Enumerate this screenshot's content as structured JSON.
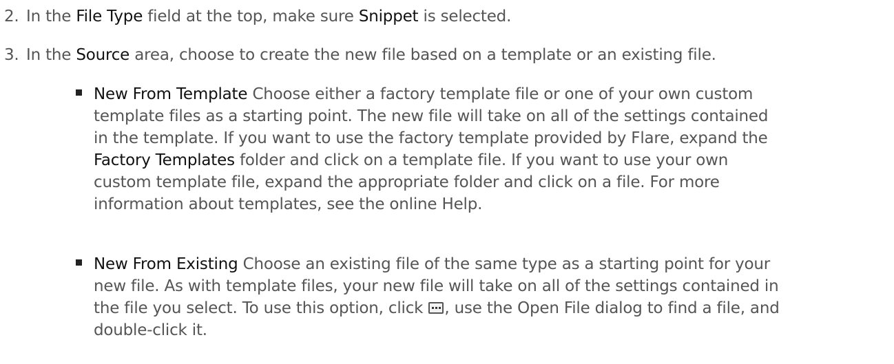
{
  "steps": [
    {
      "number": "2.",
      "parts": [
        "In the ",
        "File Type",
        " field at the top, make sure ",
        "Snippet",
        " is selected."
      ]
    },
    {
      "number": "3.",
      "parts": [
        "In the ",
        "Source",
        " area, choose to create the new file based on a template or an existing file."
      ]
    }
  ],
  "options": [
    {
      "title": "New From Template",
      "lines": [
        " Choose either a factory template file or one of your own custom",
        "template files as a starting point. The new file will take on all of the settings contained",
        "in the template. If you want to use the factory template provided by Flare, expand the",
        "",
        "custom template file, expand the appropriate folder and click on a file. For more",
        "information about templates, see the online Help."
      ],
      "factory_templates_term": "Factory Templates",
      "line4_rest": " folder and click on a template file. If you want to use your own"
    },
    {
      "title": "New From Existing",
      "lines": [
        " Choose an existing file of the same type as a starting point for your",
        "new file. As with template files, your new file will take on all of the settings contained in",
        "the file you select. To use this option, click ",
        ", use the Open File dialog to find a file, and",
        "double-click it."
      ],
      "button_icon": "ellipsis-button-icon"
    }
  ]
}
